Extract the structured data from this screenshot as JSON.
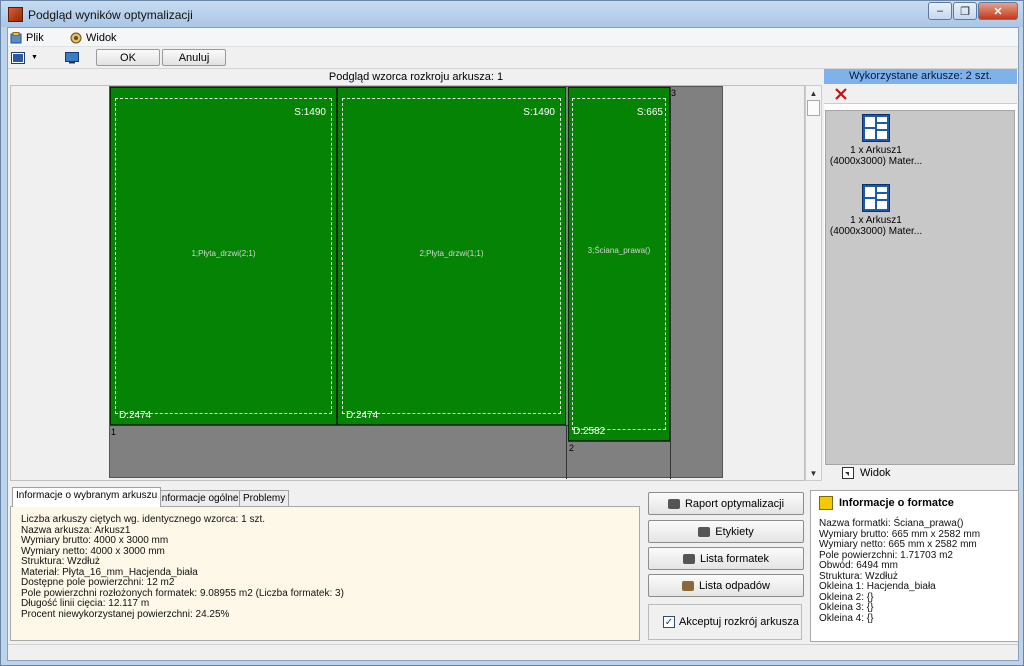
{
  "window": {
    "title": "Podgląd wyników optymalizacji",
    "minimize": "‒",
    "restore": "❐",
    "close": "✕"
  },
  "menu": {
    "items": [
      {
        "label": "Plik",
        "icon": "file-menu-icon"
      },
      {
        "label": "Widok",
        "icon": "view-menu-icon"
      }
    ]
  },
  "toolbar": {
    "ok_label": "OK",
    "cancel_label": "Anuluj"
  },
  "sheet_view": {
    "header": "Podgląd wzorca rozkroju arkusza: 1",
    "parts": [
      {
        "name": "1;Płyta_drzwi(2;1)",
        "s_label": "S:1490",
        "d_label": "D:2474"
      },
      {
        "name": "2;Płyta_drzwi(1;1)",
        "s_label": "S:1490",
        "d_label": "D:2474"
      },
      {
        "name": "3;Ściana_prawa()",
        "s_label": "S:665",
        "d_label": "D:2582"
      }
    ],
    "waste": [
      "1",
      "2",
      "3"
    ]
  },
  "used_sheets": {
    "header": "Wykorzystane arkusze: 2 szt.",
    "items": [
      {
        "line1": "1 x Arkusz1",
        "line2": "(4000x3000) Mater..."
      },
      {
        "line1": "1 x Arkusz1",
        "line2": "(4000x3000) Mater..."
      }
    ],
    "view_label": "Widok"
  },
  "tabs": [
    {
      "label": "Informacje o wybranym arkuszu",
      "active": true
    },
    {
      "label": "Informacje ogólne",
      "active": false
    },
    {
      "label": "Problemy",
      "active": false
    }
  ],
  "sheet_info": [
    "Liczba arkuszy ciętych wg. identycznego wzorca: 1 szt.",
    "Nazwa arkusza: Arkusz1",
    "Wymiary brutto: 4000 x 3000 mm",
    "Wymiary netto: 4000 x 3000 mm",
    "Struktura: Wzdłuż",
    "Materiał: Płyta_16_mm_Hacjenda_biała",
    "Dostępne pole powierzchni: 12 m2",
    "Pole powierzchni rozłożonych formatek: 9.08955 m2  (Liczba formatek: 3)",
    "Długość linii cięcia: 12.117 m",
    "Procent niewykorzystanej powierzchni: 24.25%"
  ],
  "actions": {
    "report": "Raport optymalizacji",
    "labels": "Etykiety",
    "format_list": "Lista formatek",
    "waste_list": "Lista odpadów",
    "accept": "Akceptuj rozkrój arkusza",
    "accept_checked": "✓"
  },
  "format_info": {
    "title": "Informacje o formatce",
    "lines": [
      "Nazwa formatki: Ściana_prawa()",
      "Wymiary brutto: 665 mm x 2582 mm",
      "Wymiary netto: 665 mm x 2582 mm",
      "Pole powierzchni: 1.71703 m2",
      "Obwód: 6494 mm",
      "Struktura: Wzdłuż",
      "Okleina 1: Hacjenda_biała",
      "Okleina 2: {}",
      "Okleina 3: {}",
      "Okleina 4: {}"
    ]
  },
  "colors": {
    "part_fill": "#058305",
    "waste_fill": "#808080",
    "accent_header": "#7fb2ea",
    "info_bg": "#fdf8e8"
  }
}
